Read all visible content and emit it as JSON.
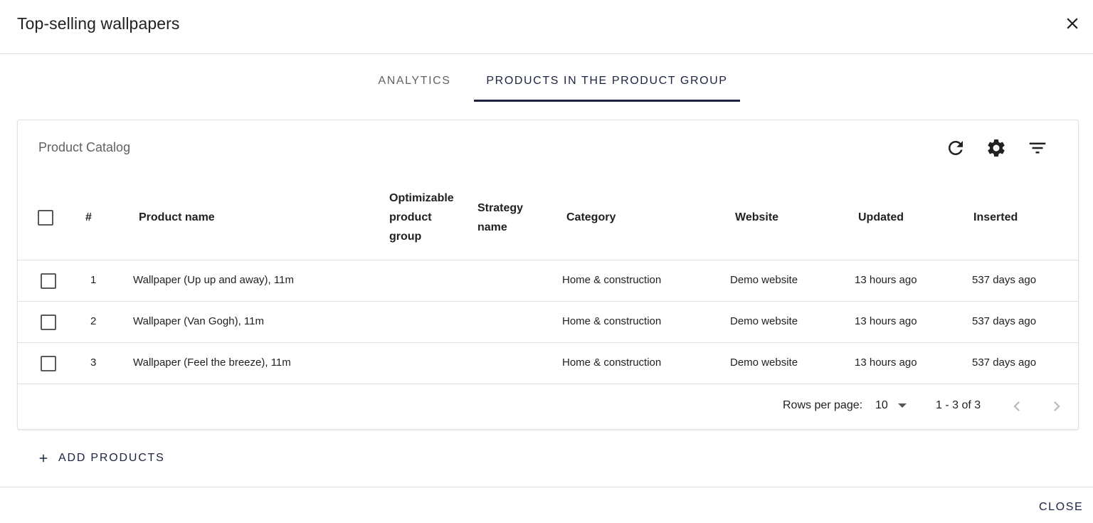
{
  "dialog": {
    "title": "Top-selling wallpapers",
    "close_icon": "close-icon",
    "close_label": "CLOSE"
  },
  "tabs": [
    {
      "label": "ANALYTICS",
      "active": false
    },
    {
      "label": "PRODUCTS IN THE PRODUCT GROUP",
      "active": true
    }
  ],
  "catalog": {
    "title": "Product Catalog",
    "toolbar_icons": [
      "refresh-icon",
      "gear-icon",
      "filter-icon"
    ],
    "columns": {
      "index": "#",
      "product_name": "Product name",
      "optimizable_group": "Optimizable product group",
      "strategy": "Strategy name",
      "category": "Category",
      "website": "Website",
      "updated": "Updated",
      "inserted": "Inserted"
    },
    "rows": [
      {
        "index": "1",
        "product_name": "Wallpaper (Up up and away), 11m",
        "optimizable_group": "",
        "strategy": "",
        "category": "Home & construction",
        "website": "Demo website",
        "updated": "13 hours ago",
        "inserted": "537 days ago"
      },
      {
        "index": "2",
        "product_name": "Wallpaper (Van Gogh), 11m",
        "optimizable_group": "",
        "strategy": "",
        "category": "Home & construction",
        "website": "Demo website",
        "updated": "13 hours ago",
        "inserted": "537 days ago"
      },
      {
        "index": "3",
        "product_name": "Wallpaper (Feel the breeze), 11m",
        "optimizable_group": "",
        "strategy": "",
        "category": "Home & construction",
        "website": "Demo website",
        "updated": "13 hours ago",
        "inserted": "537 days ago"
      }
    ],
    "pagination": {
      "rows_per_page_label": "Rows per page:",
      "rows_per_page": "10",
      "range": "1 - 3 of 3"
    }
  },
  "actions": {
    "add_products": "ADD PRODUCTS"
  },
  "colors": {
    "accent": "#1c2340",
    "divider": "#e0e0e0",
    "muted": "#616161"
  }
}
